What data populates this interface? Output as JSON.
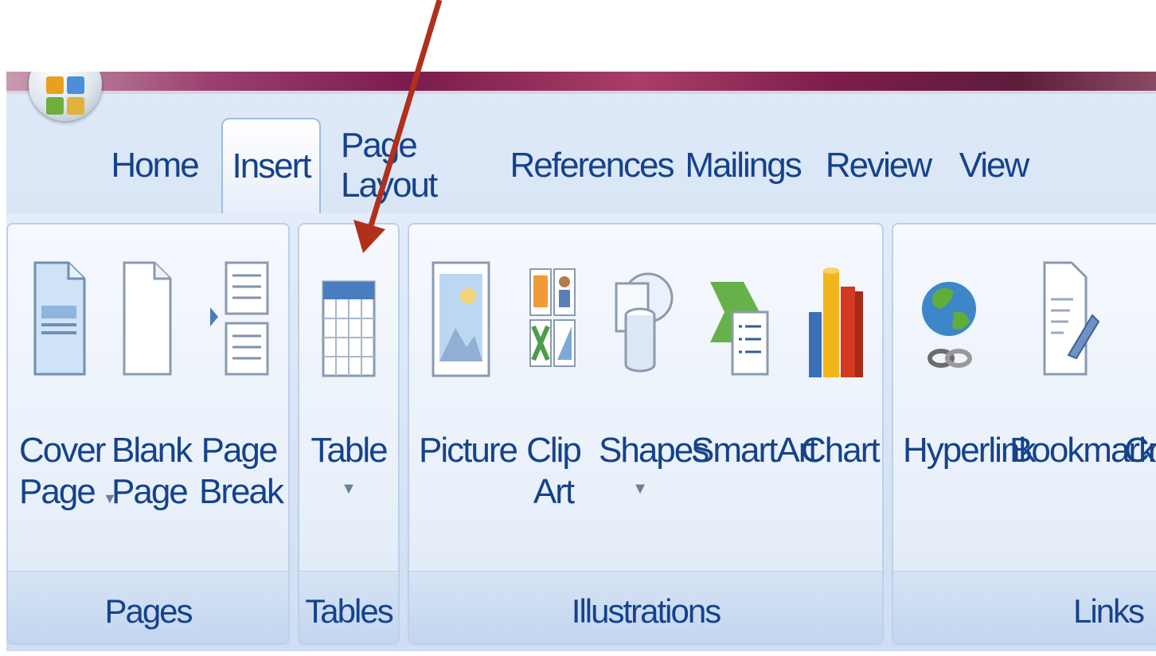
{
  "tabs": [
    {
      "label": "Home",
      "active": false
    },
    {
      "label": "Insert",
      "active": true
    },
    {
      "label": "Page Layout",
      "active": false
    },
    {
      "label": "References",
      "active": false
    },
    {
      "label": "Mailings",
      "active": false
    },
    {
      "label": "Review",
      "active": false
    },
    {
      "label": "View",
      "active": false
    }
  ],
  "groups": {
    "pages": {
      "label": "Pages",
      "cover_page": {
        "line1": "Cover",
        "line2": "Page",
        "dropdown": "▼"
      },
      "blank_page": {
        "line1": "Blank",
        "line2": "Page"
      },
      "page_break": {
        "line1": "Page",
        "line2": "Break"
      }
    },
    "tables": {
      "label": "Tables",
      "table": {
        "line1": "Table",
        "dropdown": "▼"
      }
    },
    "illustrations": {
      "label": "Illustrations",
      "picture": {
        "line1": "Picture"
      },
      "clip_art": {
        "line1": "Clip",
        "line2": "Art"
      },
      "shapes": {
        "line1": "Shapes",
        "dropdown": "▼"
      },
      "smartart": {
        "line1": "SmartArt"
      },
      "chart": {
        "line1": "Chart"
      }
    },
    "links": {
      "label": "Links",
      "hyperlink": {
        "line1": "Hyperlink"
      },
      "bookmark": {
        "line1": "Bookmark"
      },
      "cross_reference": {
        "line1": "Cro"
      }
    }
  },
  "annotation": {
    "arrow_color": "#b0301c"
  },
  "colors": {
    "tab_text": "#15428b",
    "ribbon_bg": "#dfeaf8",
    "titlebar": "#7b1c4c"
  }
}
